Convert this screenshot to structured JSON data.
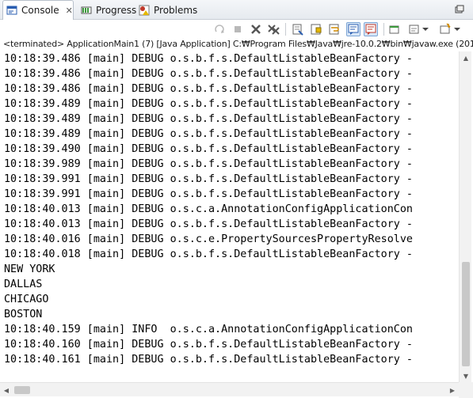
{
  "tabs": [
    {
      "label": "Console",
      "icon": "console-icon",
      "active": true
    },
    {
      "label": "Progress",
      "icon": "progress-icon",
      "active": false
    },
    {
      "label": "Problems",
      "icon": "problems-icon",
      "active": false
    }
  ],
  "tab_close_glyph": "✕",
  "status_line": "<terminated> ApplicationMain1 (7) [Java Application] C:₩Program Files₩Java₩jre-10.0.2₩bin₩javaw.exe (201",
  "console_lines": [
    "10:18:39.486 [main] DEBUG o.s.b.f.s.DefaultListableBeanFactory - ",
    "10:18:39.486 [main] DEBUG o.s.b.f.s.DefaultListableBeanFactory - ",
    "10:18:39.486 [main] DEBUG o.s.b.f.s.DefaultListableBeanFactory - ",
    "10:18:39.489 [main] DEBUG o.s.b.f.s.DefaultListableBeanFactory - ",
    "10:18:39.489 [main] DEBUG o.s.b.f.s.DefaultListableBeanFactory - ",
    "10:18:39.489 [main] DEBUG o.s.b.f.s.DefaultListableBeanFactory - ",
    "10:18:39.490 [main] DEBUG o.s.b.f.s.DefaultListableBeanFactory - ",
    "10:18:39.989 [main] DEBUG o.s.b.f.s.DefaultListableBeanFactory - ",
    "10:18:39.991 [main] DEBUG o.s.b.f.s.DefaultListableBeanFactory - ",
    "10:18:39.991 [main] DEBUG o.s.b.f.s.DefaultListableBeanFactory - ",
    "10:18:40.013 [main] DEBUG o.s.c.a.AnnotationConfigApplicationCon",
    "10:18:40.013 [main] DEBUG o.s.b.f.s.DefaultListableBeanFactory - ",
    "10:18:40.016 [main] DEBUG o.s.c.e.PropertySourcesPropertyResolve",
    "10:18:40.018 [main] DEBUG o.s.b.f.s.DefaultListableBeanFactory - ",
    "NEW YORK",
    "DALLAS",
    "CHICAGO",
    "BOSTON",
    "10:18:40.159 [main] INFO  o.s.c.a.AnnotationConfigApplicationCon",
    "10:18:40.160 [main] DEBUG o.s.b.f.s.DefaultListableBeanFactory - ",
    "10:18:40.161 [main] DEBUG o.s.b.f.s.DefaultListableBeanFactory - "
  ],
  "colors": {
    "console_blue": "#2a5db0",
    "progress_green": "#3c9a3c",
    "problems_red": "#c0392b",
    "pressed_bg": "#d7e6f7"
  }
}
